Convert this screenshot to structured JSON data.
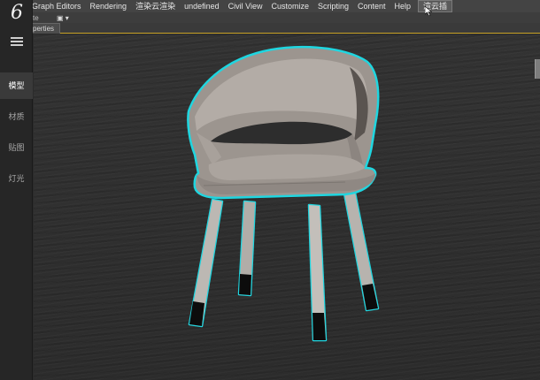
{
  "app": {
    "logo_glyph": "6"
  },
  "menubar": {
    "items": [
      "Graph Editors",
      "Rendering",
      "渲染云渲染",
      "undefined",
      "Civil View",
      "Customize",
      "Scripting",
      "Content",
      "Help",
      "渲云插"
    ],
    "active_index": 9
  },
  "toolbar2": {
    "fragment": "te",
    "control": "▣ ▾"
  },
  "tabs": {
    "label": "perties"
  },
  "sidebar": {
    "items": [
      {
        "label": "模型",
        "active": true
      },
      {
        "label": "材质",
        "active": false
      },
      {
        "label": "贴图",
        "active": false
      },
      {
        "label": "灯光",
        "active": false
      }
    ]
  },
  "viewport": {
    "object": "chair",
    "selection_color": "#1fd6e0",
    "seat_color": "#a79f99",
    "leg_color": "#b9b5b0",
    "foot_color": "#0c0c0c"
  }
}
